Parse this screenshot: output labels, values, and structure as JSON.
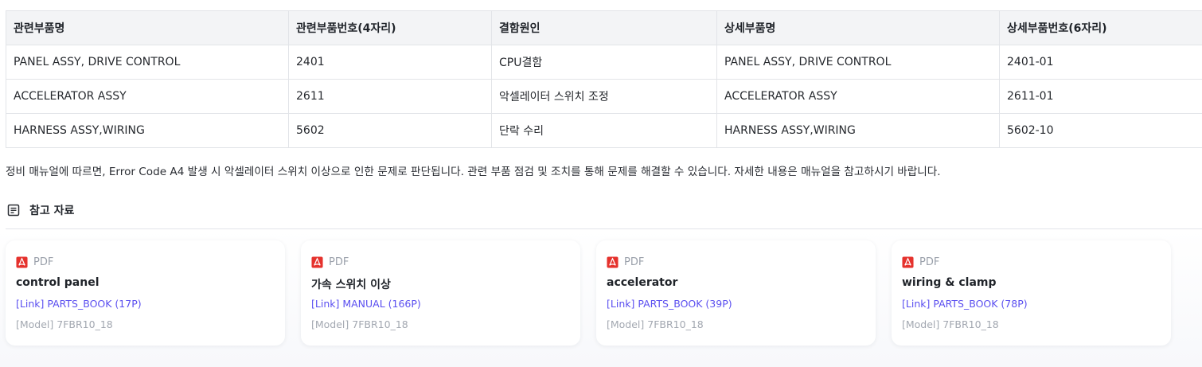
{
  "table": {
    "headers": [
      "관련부품명",
      "관련부품번호(4자리)",
      "결함원인",
      "상세부품명",
      "상세부품번호(6자리)"
    ],
    "rows": [
      [
        "PANEL ASSY, DRIVE CONTROL",
        "2401",
        "CPU결함",
        "PANEL ASSY, DRIVE CONTROL",
        "2401-01"
      ],
      [
        "ACCELERATOR ASSY",
        "2611",
        "악셀레이터 스위치 조정",
        "ACCELERATOR ASSY",
        "2611-01"
      ],
      [
        "HARNESS ASSY,WIRING",
        "5602",
        "단락 수리",
        "HARNESS ASSY,WIRING",
        "5602-10"
      ]
    ]
  },
  "description": "정비 매뉴얼에 따르면, Error Code A4 발생 시 악셀레이터 스위치 이상으로 인한 문제로 판단됩니다. 관련 부품 점검 및 조치를 통해 문제를 해결할 수 있습니다. 자세한 내용은 매뉴얼을 참고하시기 바랍니다.",
  "references": {
    "title": "참고 자료",
    "icon": "document-list-icon",
    "cards": [
      {
        "type": "PDF",
        "title": "control panel",
        "link": "[Link] PARTS_BOOK (17P)",
        "model": "[Model] 7FBR10_18"
      },
      {
        "type": "PDF",
        "title": "가속 스위치 이상",
        "link": "[Link] MANUAL (166P)",
        "model": "[Model] 7FBR10_18"
      },
      {
        "type": "PDF",
        "title": "accelerator",
        "link": "[Link] PARTS_BOOK (39P)",
        "model": "[Model] 7FBR10_18"
      },
      {
        "type": "PDF",
        "title": "wiring & clamp",
        "link": "[Link] PARTS_BOOK (78P)",
        "model": "[Model] 7FBR10_18"
      }
    ]
  },
  "colors": {
    "header_bg": "#f3f4f6",
    "link": "#5b4ff0",
    "pdf_icon": "#e5322d",
    "muted": "#9aa0aa"
  }
}
